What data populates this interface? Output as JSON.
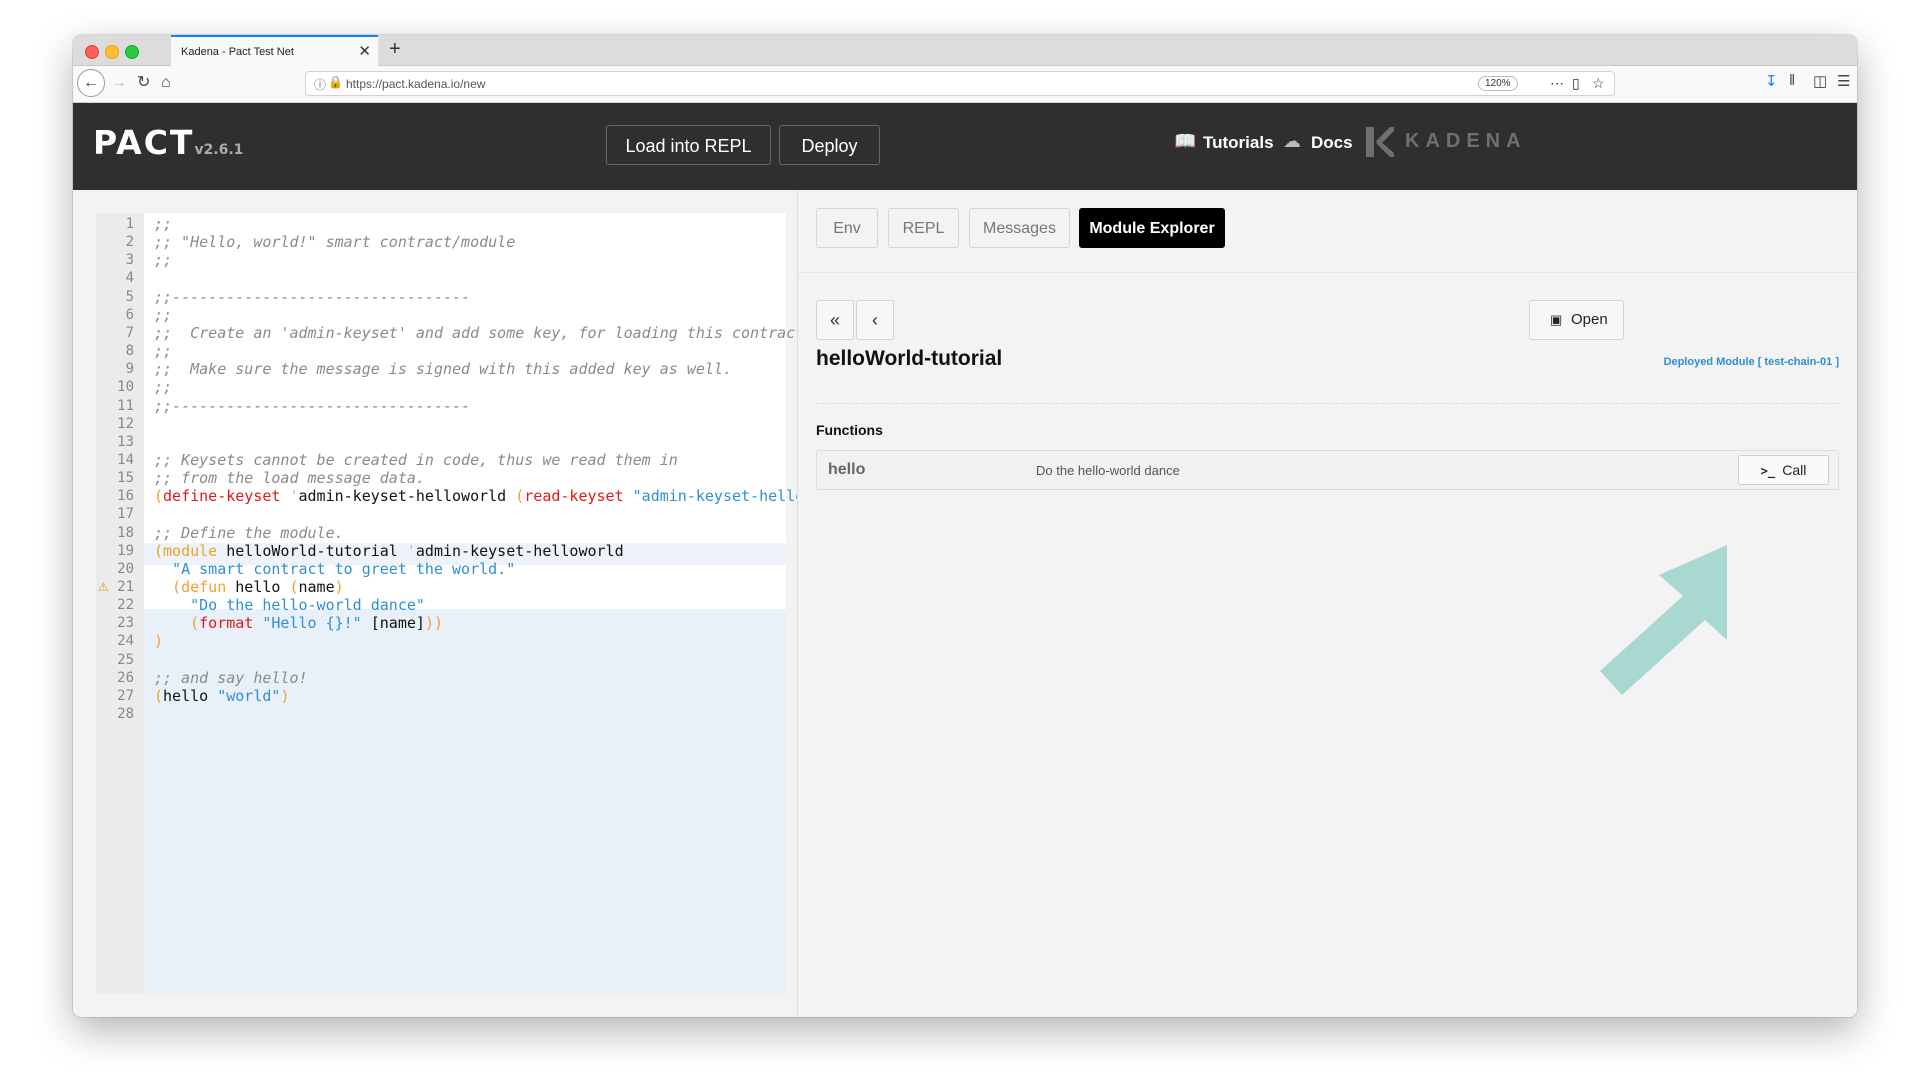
{
  "browser": {
    "tab_title": "Kadena - Pact Test Net",
    "tab_close": "✕",
    "new_tab": "+",
    "url": "https://pact.kadena.io/new",
    "zoom": "120%"
  },
  "header": {
    "logo": "PACT",
    "version": "v2.6.1",
    "load_button": "Load into REPL",
    "deploy_button": "Deploy",
    "tutorials": "Tutorials",
    "docs": "Docs",
    "brand": "KADENA"
  },
  "editor": {
    "line_numbers": [
      "1",
      "2",
      "3",
      "4",
      "5",
      "6",
      "7",
      "8",
      "9",
      "10",
      "11",
      "12",
      "13",
      "14",
      "15",
      "16",
      "17",
      "18",
      "19",
      "20",
      "21",
      "22",
      "23",
      "24",
      "25",
      "26",
      "27",
      "28"
    ],
    "warning_line": "21",
    "lines": [
      [
        {
          "t": ";;",
          "c": "com"
        }
      ],
      [
        {
          "t": ";; \"Hello, world!\" smart contract/module",
          "c": "com"
        }
      ],
      [
        {
          "t": ";;",
          "c": "com"
        }
      ],
      [],
      [
        {
          "t": ";;---------------------------------",
          "c": "com"
        }
      ],
      [
        {
          "t": ";;",
          "c": "com"
        }
      ],
      [
        {
          "t": ";;  Create an 'admin-keyset' and add some key, for loading this contract!",
          "c": "com"
        }
      ],
      [
        {
          "t": ";;",
          "c": "com"
        }
      ],
      [
        {
          "t": ";;  Make sure the message is signed with this added key as well.",
          "c": "com"
        }
      ],
      [
        {
          "t": ";;",
          "c": "com"
        }
      ],
      [
        {
          "t": ";;---------------------------------",
          "c": "com"
        }
      ],
      [],
      [],
      [
        {
          "t": ";; Keysets cannot be created in code, thus we read them in",
          "c": "com"
        }
      ],
      [
        {
          "t": ";; from the load message data.",
          "c": "com"
        }
      ],
      [
        {
          "t": "(",
          "c": "par"
        },
        {
          "t": "define-keyset",
          "c": "kw"
        },
        {
          "t": " '",
          "c": "sym"
        },
        {
          "t": "admin-keyset-helloworld ",
          "c": "id"
        },
        {
          "t": "(",
          "c": "par"
        },
        {
          "t": "read-keyset",
          "c": "kw"
        },
        {
          "t": " \"admin-keyset-helloworld",
          "c": "str"
        }
      ],
      [],
      [
        {
          "t": ";; Define the module.",
          "c": "com"
        }
      ],
      [
        {
          "t": "(",
          "c": "par"
        },
        {
          "t": "module",
          "c": "par"
        },
        {
          "t": " helloWorld-tutorial",
          "c": "id"
        },
        {
          "t": " '",
          "c": "sym"
        },
        {
          "t": "admin-keyset-helloworld",
          "c": "id"
        }
      ],
      [
        {
          "t": "  \"A smart contract to greet the world.\"",
          "c": "str"
        }
      ],
      [
        {
          "t": "  (",
          "c": "par"
        },
        {
          "t": "defun",
          "c": "par"
        },
        {
          "t": " hello ",
          "c": "id"
        },
        {
          "t": "(",
          "c": "par"
        },
        {
          "t": "name",
          "c": "id"
        },
        {
          "t": ")",
          "c": "par"
        }
      ],
      [
        {
          "t": "    \"Do the hello-world dance\"",
          "c": "str"
        }
      ],
      [
        {
          "t": "    (",
          "c": "par"
        },
        {
          "t": "format",
          "c": "kw"
        },
        {
          "t": " \"Hello {}!\"",
          "c": "str"
        },
        {
          "t": " [name]",
          "c": "id"
        },
        {
          "t": "))",
          "c": "par"
        }
      ],
      [
        {
          "t": ")",
          "c": "par"
        }
      ],
      [],
      [
        {
          "t": ";; and say hello!",
          "c": "com"
        }
      ],
      [
        {
          "t": "(",
          "c": "par"
        },
        {
          "t": "hello ",
          "c": "id"
        },
        {
          "t": "\"world\"",
          "c": "str"
        },
        {
          "t": ")",
          "c": "par"
        }
      ],
      []
    ]
  },
  "panel": {
    "tabs": [
      "Env",
      "REPL",
      "Messages",
      "Module Explorer"
    ],
    "active_tab": "Module Explorer",
    "open_button": "Open",
    "module_title": "helloWorld-tutorial",
    "deployed_label": "Deployed Module [ test-chain-01 ]",
    "functions_heading": "Functions",
    "functions": [
      {
        "name": "hello",
        "description": "Do the hello-world dance",
        "call_label": "Call"
      }
    ]
  },
  "colors": {
    "arrow": "#a8d8cf",
    "accent_blue": "#2f8fd0",
    "keyword_red": "#e01a1a",
    "paren_orange": "#f0a030"
  },
  "icons": {
    "double_back": "chevrons-left-icon",
    "back": "chevron-left-icon",
    "open": "window-icon",
    "call": "terminal-icon"
  }
}
